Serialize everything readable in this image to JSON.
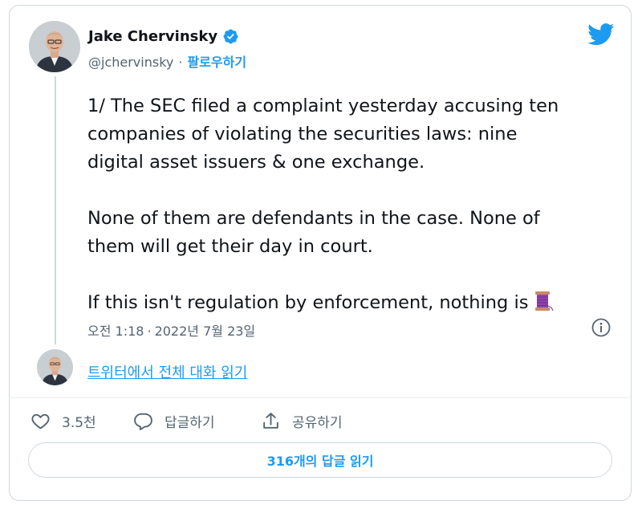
{
  "author": {
    "name": "Jake Chervinsky",
    "handle": "@jchervinsky",
    "separator": "·",
    "follow_label": "팔로우하기",
    "verified": true
  },
  "tweet": {
    "paragraphs": [
      [
        "1/ The SEC filed a complaint yesterday accusing ten",
        "companies of violating the securities laws: nine",
        "digital asset issuers & one exchange."
      ],
      [
        "None of them are defendants in the case. None of",
        "them will get their day in court."
      ],
      [
        "If this isn't regulation by enforcement, nothing is"
      ]
    ],
    "trailing_emoji": "thread-spool-emoji",
    "time": "오전 1:18",
    "separator": "·",
    "date": "2022년 7월 23일"
  },
  "thread_link": "트위터에서 전체 대화 읽기",
  "actions": {
    "like_count": "3.5천",
    "reply_label": "답글하기",
    "share_label": "공유하기"
  },
  "replies_button": "316개의 답글 읽기",
  "icons": {
    "brand": "twitter-bird-icon",
    "verified": "verified-badge-icon",
    "info": "info-icon",
    "like": "heart-icon",
    "reply": "speech-bubble-icon",
    "share": "share-upload-icon"
  },
  "colors": {
    "accent": "#1d9bf0",
    "text": "#0f1419",
    "muted": "#536471",
    "border": "#cfd9de"
  }
}
